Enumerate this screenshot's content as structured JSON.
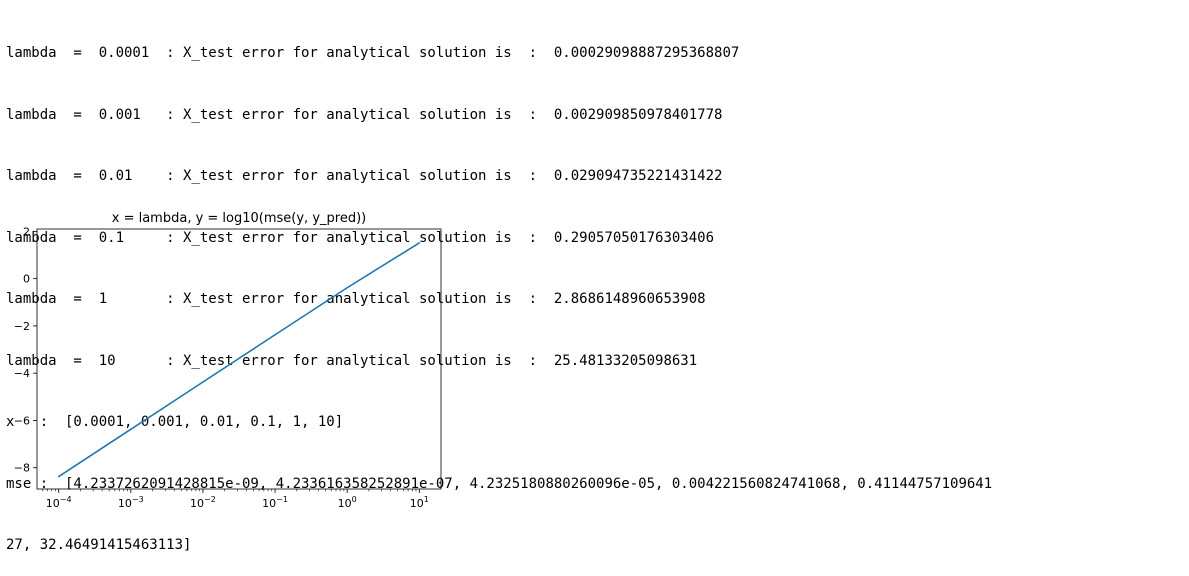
{
  "output_lines": [
    "lambda  =  0.0001  : X_test error for analytical solution is  :  0.00029098887295368807",
    "lambda  =  0.001   : X_test error for analytical solution is  :  0.002909850978401778",
    "lambda  =  0.01    : X_test error for analytical solution is  :  0.029094735221431422",
    "lambda  =  0.1     : X_test error for analytical solution is  :  0.29057050176303406",
    "lambda  =  1       : X_test error for analytical solution is  :  2.8686148960653908",
    "lambda  =  10      : X_test error for analytical solution is  :  25.48133205098631",
    "x   :  [0.0001, 0.001, 0.01, 0.1, 1, 10]",
    "mse :  [4.2337262091428815e-09, 4.233616358252891e-07, 4.2325180880260096e-05, 0.004221560824741068, 0.41144757109641",
    "27, 32.46491415463113]"
  ],
  "chart_data": {
    "type": "line",
    "title": "x = lambda, y = log10(mse(y, y_pred))",
    "x_scale": "log",
    "x": [
      0.0001,
      0.001,
      0.01,
      0.1,
      1,
      10
    ],
    "y": [
      -8.3733,
      -6.3733,
      -4.3735,
      -2.3746,
      -0.3857,
      1.5114
    ],
    "xlim": [
      5e-05,
      20
    ],
    "ylim": [
      -8.9,
      2.1
    ],
    "x_ticks": [
      {
        "base": "10",
        "exp": "−4"
      },
      {
        "base": "10",
        "exp": "−3"
      },
      {
        "base": "10",
        "exp": "−2"
      },
      {
        "base": "10",
        "exp": "−1"
      },
      {
        "base": "10",
        "exp": "0"
      },
      {
        "base": "10",
        "exp": "1"
      }
    ],
    "y_ticks": [
      {
        "value": 2,
        "label": "2"
      },
      {
        "value": 0,
        "label": "0"
      },
      {
        "value": -2,
        "label": "−2"
      },
      {
        "value": -4,
        "label": "−4"
      },
      {
        "value": -6,
        "label": "−6"
      },
      {
        "value": -8,
        "label": "−8"
      }
    ],
    "line_color": "#1f77b4",
    "grid": false,
    "xlabel": "",
    "ylabel": ""
  }
}
